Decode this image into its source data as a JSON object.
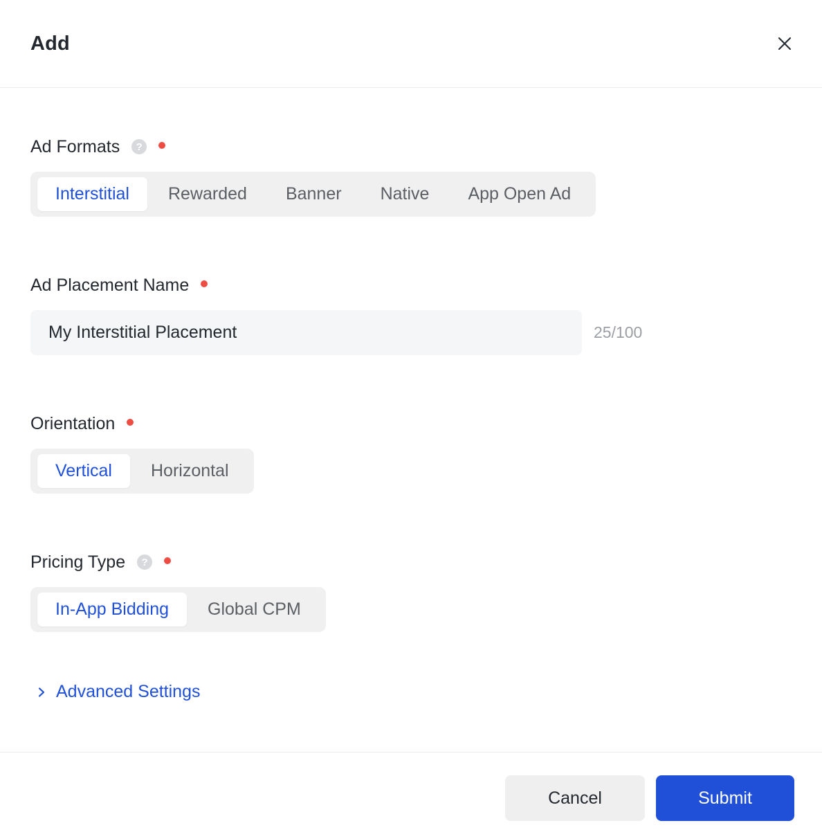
{
  "modal": {
    "title": "Add"
  },
  "form": {
    "ad_formats": {
      "label": "Ad Formats",
      "required": true,
      "has_help": true,
      "options": [
        "Interstitial",
        "Rewarded",
        "Banner",
        "Native",
        "App Open Ad"
      ],
      "selected": "Interstitial"
    },
    "ad_placement_name": {
      "label": "Ad Placement Name",
      "required": true,
      "value": "My Interstitial Placement",
      "counter": "25/100"
    },
    "orientation": {
      "label": "Orientation",
      "required": true,
      "options": [
        "Vertical",
        "Horizontal"
      ],
      "selected": "Vertical"
    },
    "pricing_type": {
      "label": "Pricing Type",
      "required": true,
      "has_help": true,
      "options": [
        "In-App Bidding",
        "Global CPM"
      ],
      "selected": "In-App Bidding"
    },
    "advanced_settings": {
      "label": "Advanced Settings"
    }
  },
  "footer": {
    "cancel_label": "Cancel",
    "submit_label": "Submit"
  },
  "colors": {
    "accent_blue": "#2050d8",
    "required_red": "#ee4d44",
    "text_dark": "#23272e",
    "text_gray": "#5b5e63",
    "seg_bg": "#f0f0f1",
    "input_bg": "#f5f6f7",
    "divider": "#ececec",
    "counter_gray": "#9b9ea3",
    "help_circle": "#d7d9dc",
    "cancel_bg": "#efefef"
  }
}
